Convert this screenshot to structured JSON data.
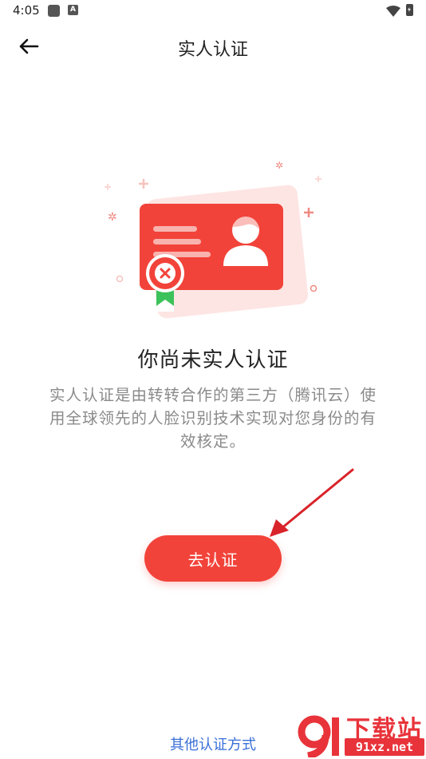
{
  "status_bar": {
    "time": "4:05",
    "app_icon_label": "A"
  },
  "header": {
    "title": "实人认证"
  },
  "main": {
    "heading": "你尚未实人认证",
    "description": "实人认证是由转转合作的第三方（腾讯云）使用全球领先的人脸识别技术实现对您身份的有效核定。",
    "verify_button": "去认证",
    "other_methods_link": "其他认证方式"
  },
  "watermark": {
    "title": "下载站",
    "domain": "91xz.net"
  },
  "colors": {
    "accent": "#f2433a",
    "link": "#3a6fd8",
    "text_primary": "#222222",
    "text_secondary": "#8a8a8a",
    "badge_green": "#3cc25a"
  }
}
